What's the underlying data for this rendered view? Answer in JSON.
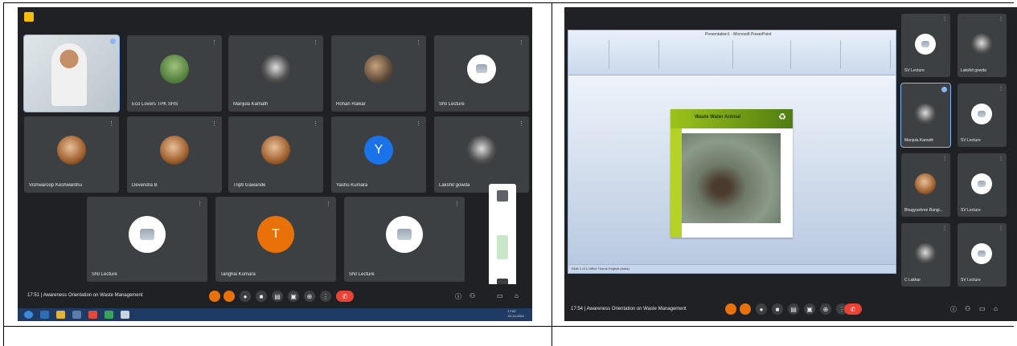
{
  "left": {
    "tiles": [
      {
        "name": "",
        "kind": "video",
        "pinned": true
      },
      {
        "name": "Eco Lovers TPK SHS",
        "kind": "green"
      },
      {
        "name": "Manjula Kamath",
        "kind": "bw"
      },
      {
        "name": "Rohan Raikar",
        "kind": "photo"
      },
      {
        "name": "SNI Lecture",
        "kind": "logo"
      },
      {
        "name": "Vishwaroop Keshwanthu",
        "kind": "warm"
      },
      {
        "name": "Devendra B",
        "kind": "warm"
      },
      {
        "name": "Tripti Gawande",
        "kind": "warm"
      },
      {
        "name": "Yashu Kumara",
        "kind": "letter",
        "letter": "Y",
        "color": "#1a73e8"
      },
      {
        "name": "Lakshit gowda",
        "kind": "bw"
      },
      {
        "name": "SNI Lecture",
        "kind": "logo"
      },
      {
        "name": "Tanghai Kumara",
        "kind": "letter",
        "letter": "T",
        "color": "#e8710a"
      },
      {
        "name": "SNI Lecture",
        "kind": "logo"
      }
    ],
    "meeting_title": "17:51 | Awareness Orientation on Waste Management",
    "taskbar_clock": "17:52\n22-12-2021"
  },
  "right": {
    "ppt_title": "Presentation1 - Microsoft PowerPoint",
    "slide_title": "Waste Water Animal",
    "status_text": "Slide 1 of 1   Office Theme   English (India)",
    "tiles": [
      {
        "name": "SV Lecture",
        "kind": "logo"
      },
      {
        "name": "Lakshit gowda",
        "kind": "bw"
      },
      {
        "name": "Manjula Kamath",
        "kind": "bw",
        "active": true
      },
      {
        "name": "SV Lecture",
        "kind": "logo"
      },
      {
        "name": "Bhagyashree Bangi...",
        "kind": "warm"
      },
      {
        "name": "SV Lecture",
        "kind": "logo"
      },
      {
        "name": "C Lakkar",
        "kind": "bw"
      },
      {
        "name": "SV Lecture",
        "kind": "logo"
      }
    ],
    "meeting_title": "17:54 | Awareness Orientation on Waste Management"
  },
  "icons": {
    "more": "more-vert-icon",
    "mic": "mic-icon",
    "camera": "camera-icon",
    "end": "end-call-icon"
  }
}
